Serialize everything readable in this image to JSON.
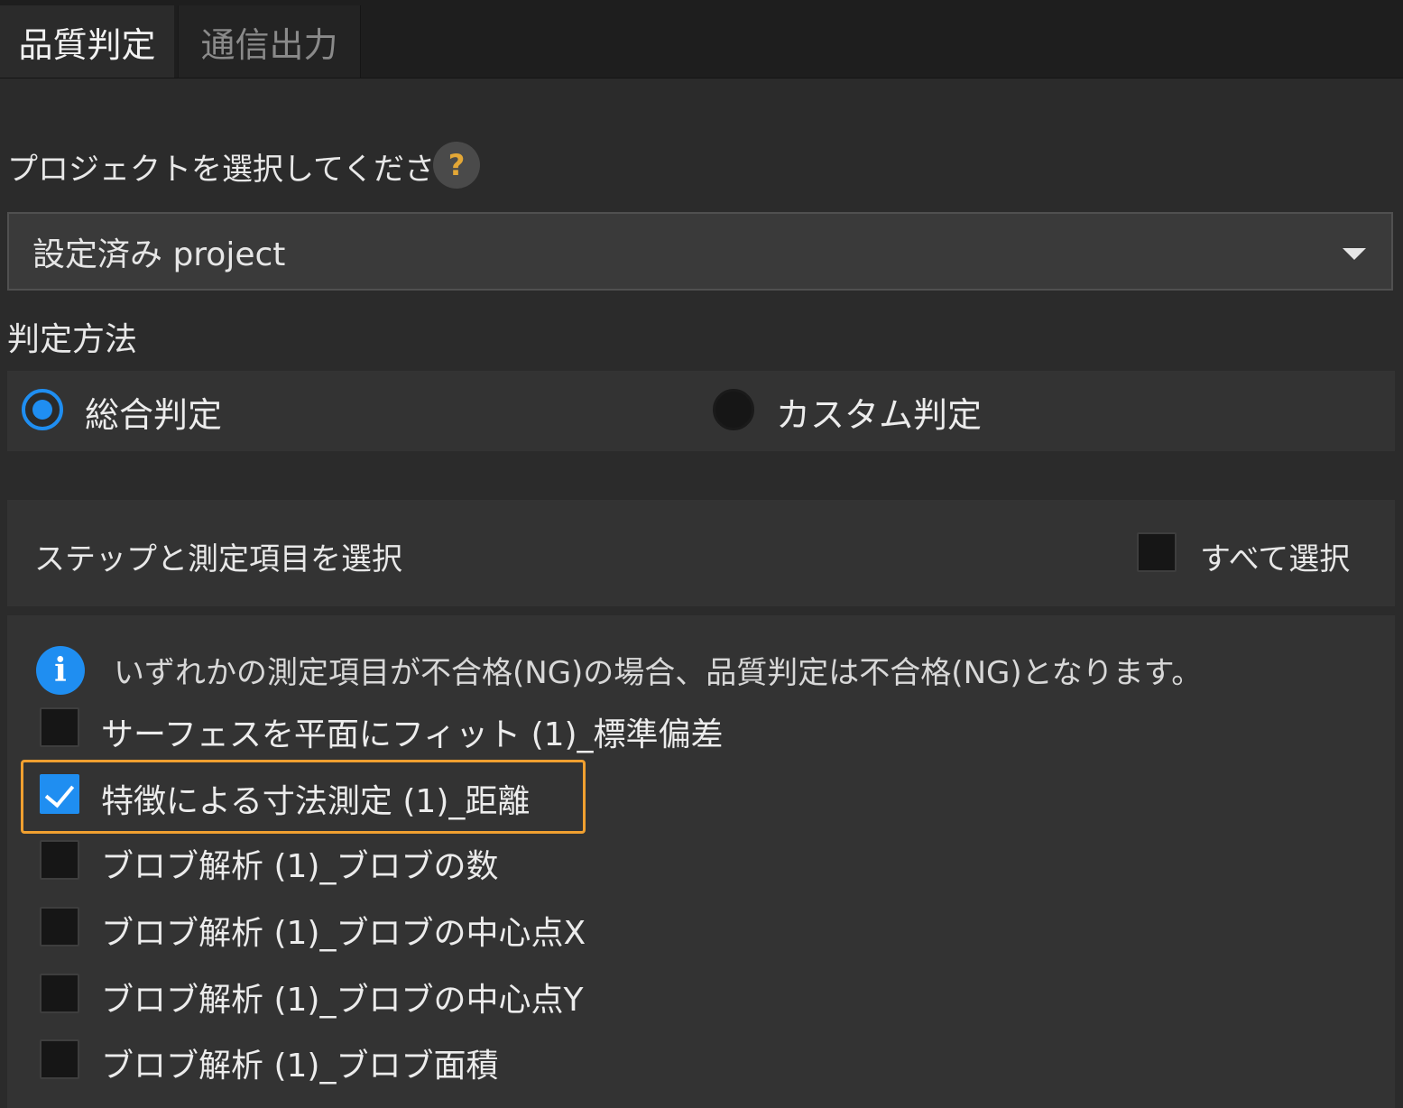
{
  "tabs": [
    {
      "label": "品質判定",
      "active": true
    },
    {
      "label": "通信出力",
      "active": false
    }
  ],
  "project": {
    "label": "プロジェクトを選択してください",
    "help_icon": "question-icon",
    "selected": "設定済み project"
  },
  "method": {
    "label": "判定方法",
    "options": [
      {
        "label": "総合判定",
        "selected": true
      },
      {
        "label": "カスタム判定",
        "selected": false
      }
    ]
  },
  "steps": {
    "title": "ステップと測定項目を選択",
    "select_all_label": "すべて選択",
    "select_all_checked": false,
    "info_icon": "info-icon",
    "info_text": "いずれかの測定項目が不合格(NG)の場合、品質判定は不合格(NG)となります。",
    "items": [
      {
        "label": "サーフェスを平面にフィット (1)_標準偏差",
        "checked": false
      },
      {
        "label": "特徴による寸法測定 (1)_距離",
        "checked": true,
        "highlighted": true
      },
      {
        "label": "ブロブ解析 (1)_ブロブの数",
        "checked": false
      },
      {
        "label": "ブロブ解析 (1)_ブロブの中心点X",
        "checked": false
      },
      {
        "label": "ブロブ解析 (1)_ブロブの中心点Y",
        "checked": false
      },
      {
        "label": "ブロブ解析 (1)_ブロブ面積",
        "checked": false
      }
    ]
  },
  "colors": {
    "accent": "#1f8ef1",
    "highlight": "#f0a030",
    "help_icon": "#e3a736"
  }
}
